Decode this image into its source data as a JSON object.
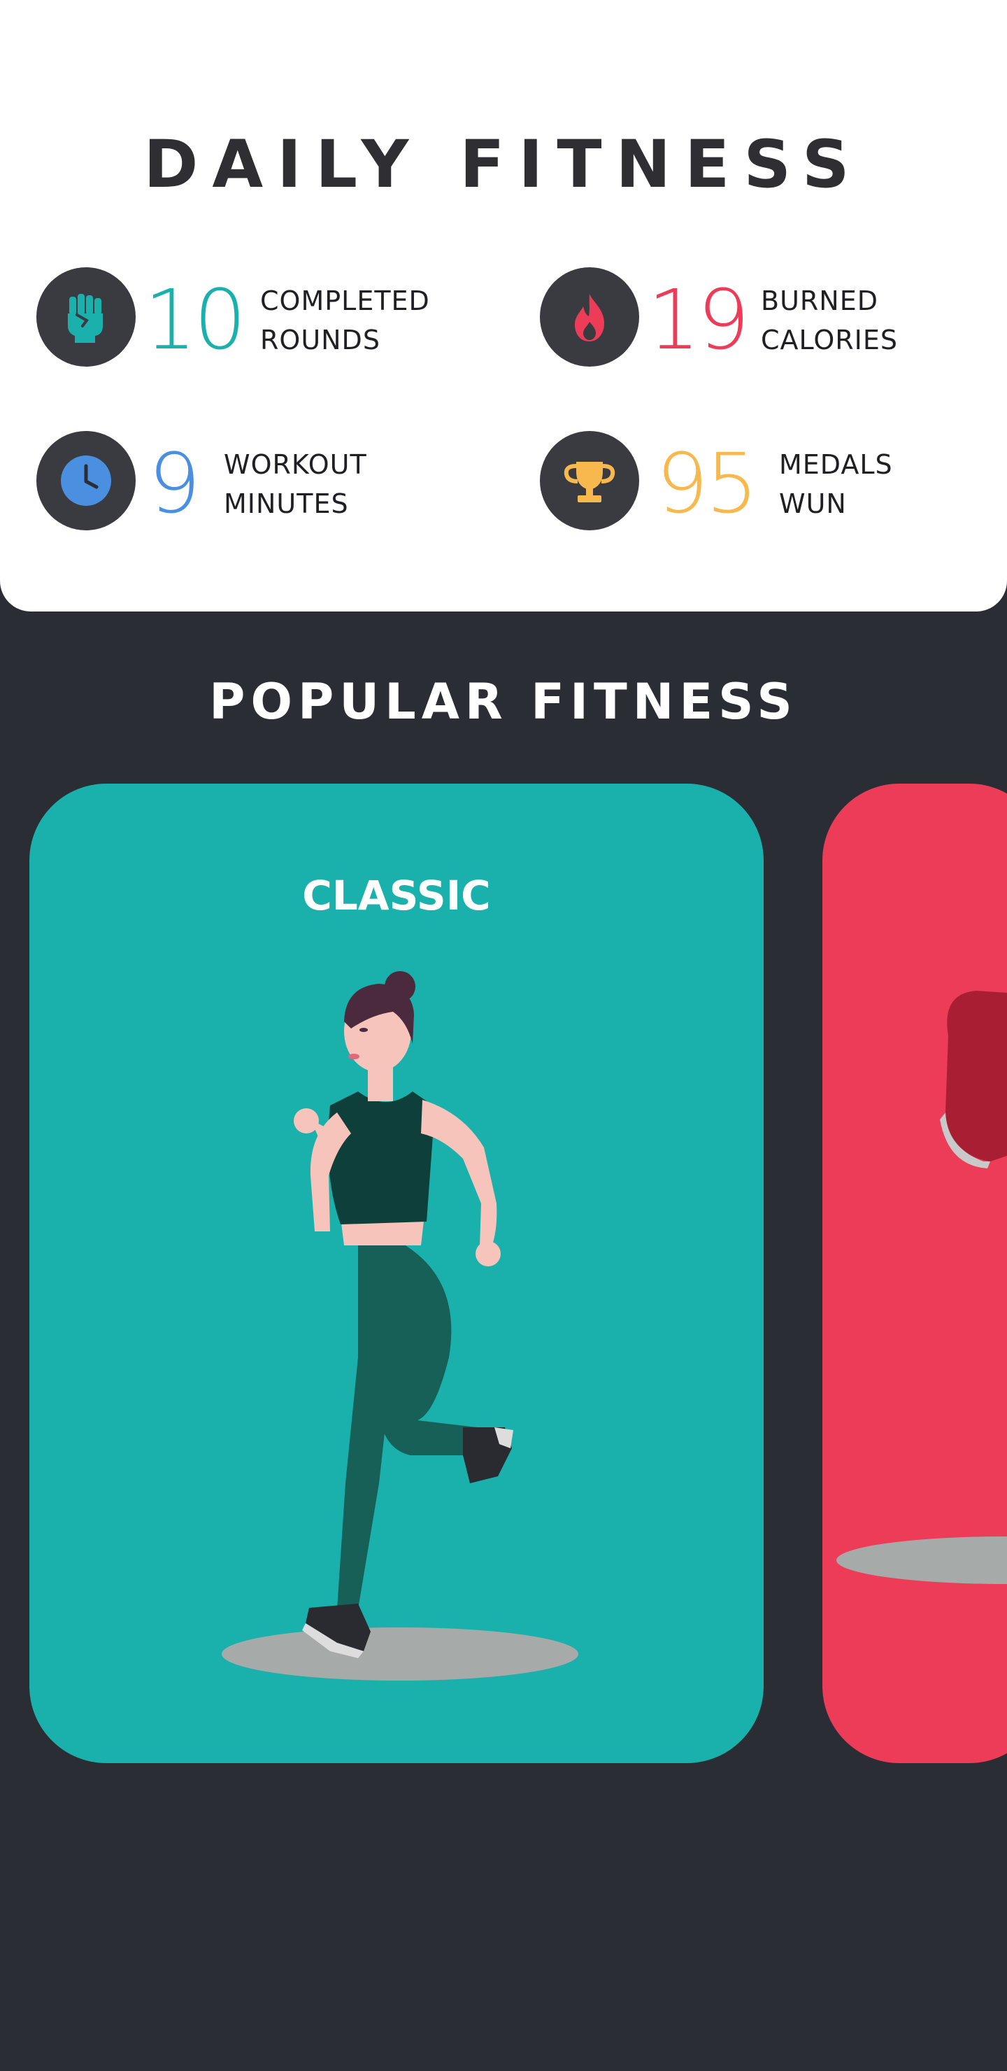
{
  "header": {
    "title": "DAILY FITNESS"
  },
  "stats": [
    {
      "value": "10",
      "label_line1": "COMPLETED",
      "label_line2": "ROUNDS",
      "color": "#1ab0ac",
      "icon": "fist-icon"
    },
    {
      "value": "19",
      "label_line1": "BURNED",
      "label_line2": "CALORIES",
      "color": "#ec3c57",
      "icon": "flame-icon"
    },
    {
      "value": "9",
      "label_line1": "WORKOUT",
      "label_line2": "MINUTES",
      "color": "#4a8fe0",
      "icon": "clock-icon"
    },
    {
      "value": "95",
      "label_line1": "MEDALS",
      "label_line2": "WUN",
      "color": "#f7b84e",
      "icon": "trophy-icon"
    }
  ],
  "popular": {
    "title": "POPULAR FITNESS",
    "cards": [
      {
        "label": "CLASSIC",
        "color": "#1ab0ac",
        "illustration": "running-woman-illustration"
      },
      {
        "label": "",
        "color": "#ec3c57",
        "illustration": "sneaker-illustration"
      }
    ]
  },
  "colors": {
    "background": "#2b2d34",
    "panel": "#ffffff",
    "icon_circle": "#3a3b40"
  }
}
